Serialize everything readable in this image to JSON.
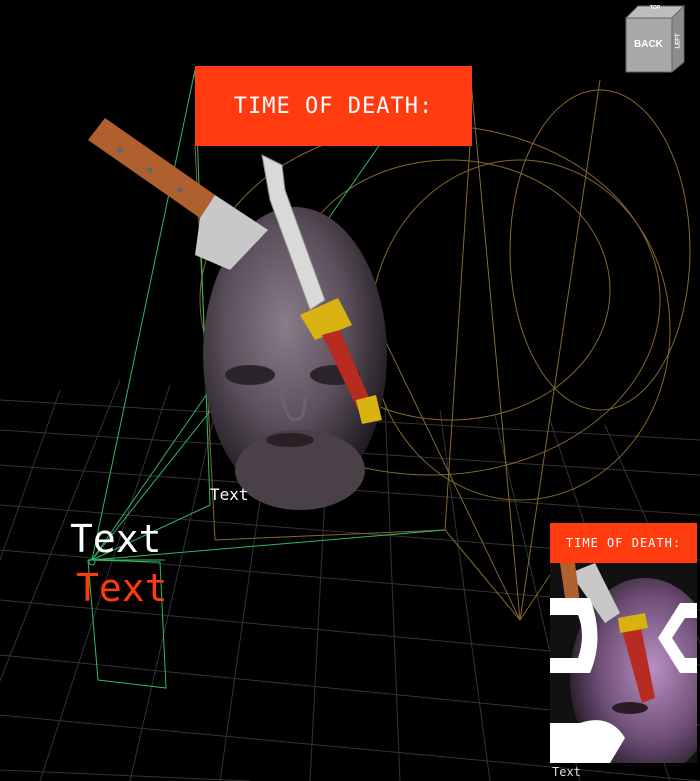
{
  "scene": {
    "banner_text": "TIME OF DEATH:",
    "label_small": "Text",
    "label_white": "Text",
    "label_red": "Text"
  },
  "viewcube": {
    "front": "BACK",
    "side": "LEFT",
    "top": "TOP"
  },
  "preview": {
    "banner_text": "TIME OF DEATH:",
    "caption": "Text"
  },
  "colors": {
    "accent": "#ff3b0f",
    "wire_green": "#3cbf6e",
    "wire_orange": "#b08a3a",
    "grid": "#3a3a3a",
    "text_red": "#ff3a10"
  }
}
